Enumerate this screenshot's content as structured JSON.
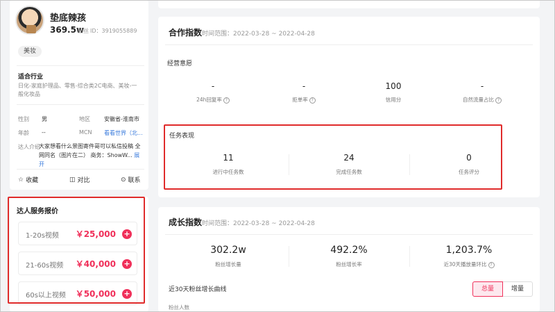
{
  "profile": {
    "name": "垫底辣孩",
    "fans_count": "369.5w",
    "fans_label": "粉丝",
    "id_text": "ID：3919055889",
    "tag": "美妆",
    "industry_title": "适合行业",
    "industry_text": "日化-家庭护理品、零售-综合类2C电商、美妆-一般化妆品",
    "gender_label": "性别",
    "gender_value": "男",
    "region_label": "地区",
    "region_value": "安徽省-淮南市",
    "age_label": "年龄",
    "age_value": "--",
    "mcn_label": "MCN",
    "mcn_value": "看看世界（北...",
    "intro_label": "达人介绍",
    "intro_text": "大家想看什么景图寄件哥可以私信投稿 全网同名（图片在二） 商务：ShowW...",
    "intro_expand": "展开",
    "actions": {
      "collect": "收藏",
      "compare": "对比",
      "contact": "联系"
    }
  },
  "pricing": {
    "title": "达人服务报价",
    "items": [
      {
        "name": "1-20s视频",
        "price": "￥25,000"
      },
      {
        "name": "21-60s视频",
        "price": "￥40,000"
      },
      {
        "name": "60s以上视频",
        "price": "￥50,000"
      }
    ]
  },
  "cooperation": {
    "title": "合作指数",
    "range": "时间范围：2022-03-28 ~ 2022-04-28",
    "intent_title": "经营意愿",
    "metrics": [
      {
        "value": "-",
        "label": "24h回复率"
      },
      {
        "value": "-",
        "label": "拒单率"
      },
      {
        "value": "100",
        "label": "信用分"
      },
      {
        "value": "-",
        "label": "自然流量占比"
      }
    ],
    "task_title": "任务表现",
    "tasks": [
      {
        "value": "11",
        "label": "进行中任务数"
      },
      {
        "value": "24",
        "label": "完成任务数"
      },
      {
        "value": "0",
        "label": "任务评分"
      }
    ]
  },
  "growth": {
    "title": "成长指数",
    "range": "时间范围：2022-03-28 ~ 2022-04-28",
    "metrics": [
      {
        "value": "302.2w",
        "label": "粉丝增长量"
      },
      {
        "value": "492.2%",
        "label": "粉丝增长率"
      },
      {
        "value": "1,203.7%",
        "label": "近30天播放量环比"
      }
    ],
    "curve_title": "近30天粉丝增长曲线",
    "y_label": "粉丝人数",
    "toggle": {
      "total": "总量",
      "increment": "增量"
    }
  }
}
